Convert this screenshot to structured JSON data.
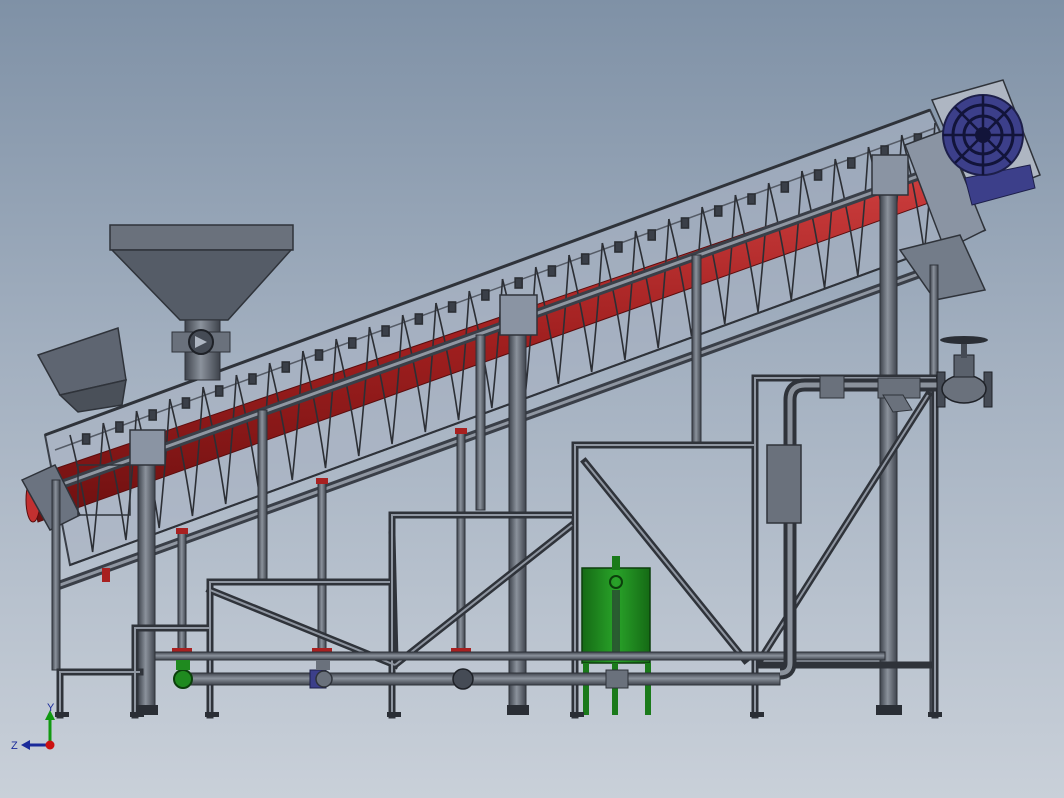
{
  "viewport": {
    "background_top": "#7f91a6",
    "background_bottom": "#c9d0d9"
  },
  "orientation_triad": {
    "y_label": "Y",
    "z_label": "Z",
    "x_axis_color": "#cc1111",
    "y_axis_color": "#119911",
    "z_axis_color": "#1a2a9a"
  },
  "model_colors": {
    "frame": "#5d6470",
    "screw": "#b52a2a",
    "tank": "#1f8a1f",
    "motor": "#3c3f8a",
    "housing": "#9aa4b3"
  }
}
